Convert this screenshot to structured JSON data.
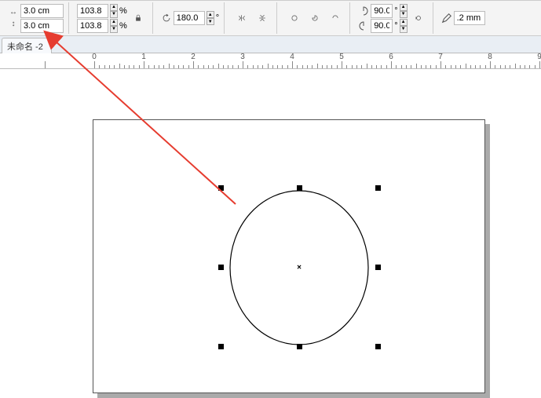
{
  "toolbar": {
    "width_value": "3.0 cm",
    "height_value": "3.0 cm",
    "scale_x": "103.8",
    "scale_y": "103.8",
    "percent_label": "%",
    "rotation": "180.0",
    "degree_label": "°",
    "arc_start": "90.0",
    "arc_end": "90.0",
    "outline_width": ".2 mm"
  },
  "tab": {
    "label": "未命名 -2"
  },
  "ruler": {
    "labels": [
      "0",
      "1",
      "2",
      "3",
      "4",
      "5",
      "6",
      "7",
      "8",
      "9"
    ]
  }
}
